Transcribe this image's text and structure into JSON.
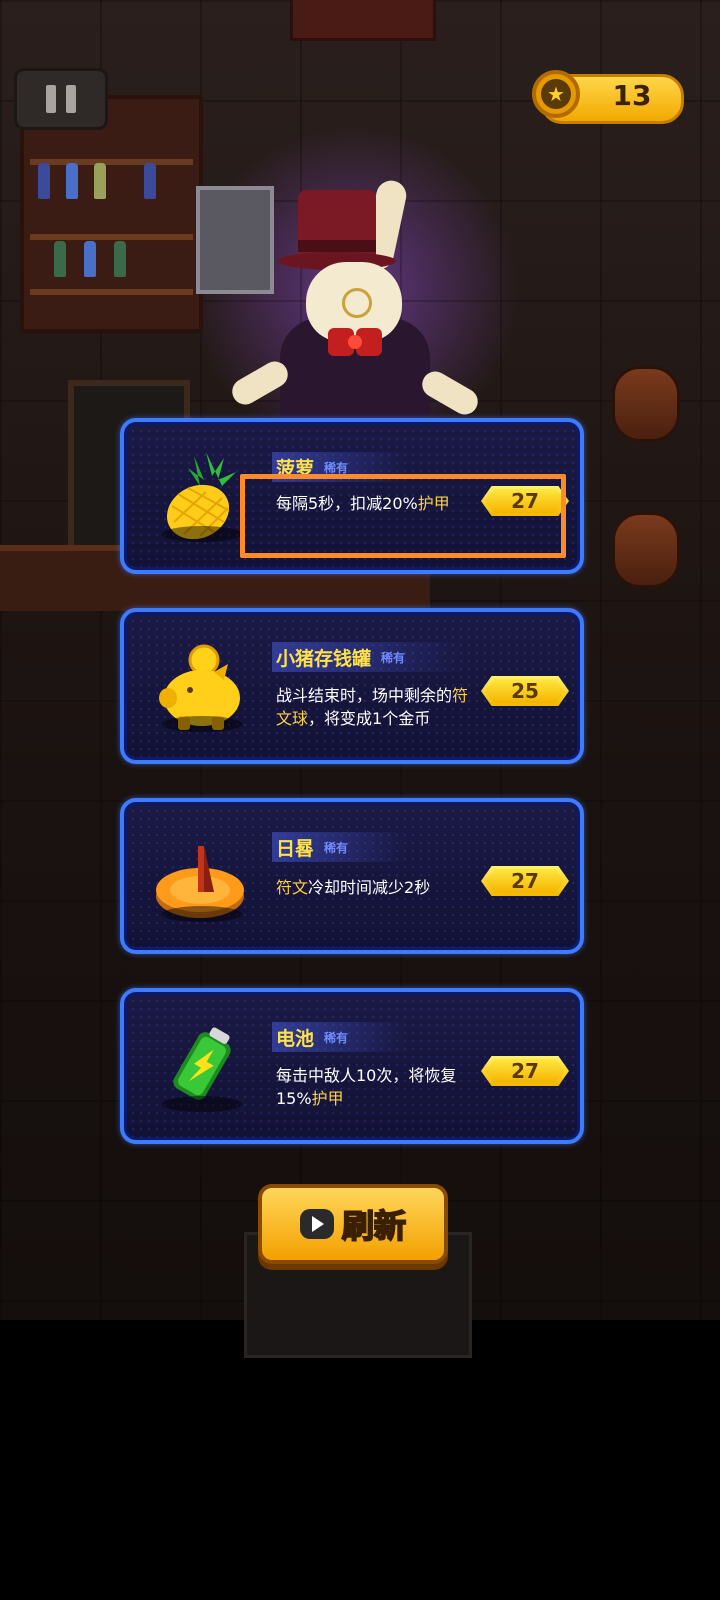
{
  "hud": {
    "pause_icon": "pause-icon",
    "coin_icon": "coin-star-icon",
    "coins": "13"
  },
  "shop_items": [
    {
      "name": "菠萝",
      "rarity": "稀有",
      "desc_parts": [
        "每隔5秒，扣减20%",
        "护甲",
        ""
      ],
      "price": "27",
      "icon": "pineapple-icon"
    },
    {
      "name": "小猪存钱罐",
      "rarity": "稀有",
      "desc_parts": [
        "战斗结束时，场中剩余的",
        "符文球",
        "，将变成1个金币"
      ],
      "price": "25",
      "icon": "piggy-bank-icon"
    },
    {
      "name": "日晷",
      "rarity": "稀有",
      "desc_parts": [
        "",
        "符文",
        "冷却时间减少2秒"
      ],
      "price": "27",
      "icon": "sundial-icon"
    },
    {
      "name": "电池",
      "rarity": "稀有",
      "desc_parts": [
        "每击中敌人10次，将恢复15%",
        "护甲",
        ""
      ],
      "price": "27",
      "icon": "battery-icon"
    }
  ],
  "refresh_button": {
    "label": "刷新",
    "icon": "play-video-icon"
  },
  "colors": {
    "card_border": "#3f7bff",
    "title": "#ffe14a",
    "highlight_text": "#ffd23a",
    "selection_box": "#ff8a2a"
  }
}
